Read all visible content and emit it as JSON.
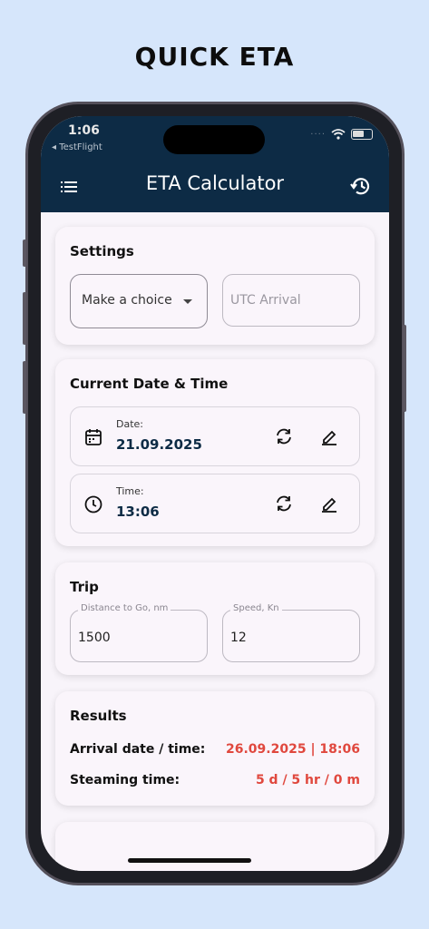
{
  "headline": "QUICK ETA",
  "status_bar": {
    "time": "1:06",
    "back_app": "◂ TestFlight",
    "signal": "····"
  },
  "app_bar": {
    "title": "ETA Calculator",
    "menu_icon": "menu-icon",
    "history_icon": "history-icon"
  },
  "settings": {
    "title": "Settings",
    "dropdown_value": "Make a choice",
    "arrival_placeholder": "UTC Arrival"
  },
  "current": {
    "title": "Current Date & Time",
    "date_label": "Date:",
    "date_value": "21.09.2025",
    "time_label": "Time:",
    "time_value": "13:06"
  },
  "trip": {
    "title": "Trip",
    "distance_label": "Distance to Go, nm",
    "distance_value": "1500",
    "speed_label": "Speed, Kn",
    "speed_value": "12"
  },
  "results": {
    "title": "Results",
    "arrival_label": "Arrival date / time:",
    "arrival_value": "26.09.2025 | 18:06",
    "steaming_label": "Steaming time:",
    "steaming_value": "5 d / 5 hr / 0 m"
  },
  "colors": {
    "app_bar": "#0d2b45",
    "result_accent": "#e0483e",
    "background": "#d6e6fb"
  }
}
